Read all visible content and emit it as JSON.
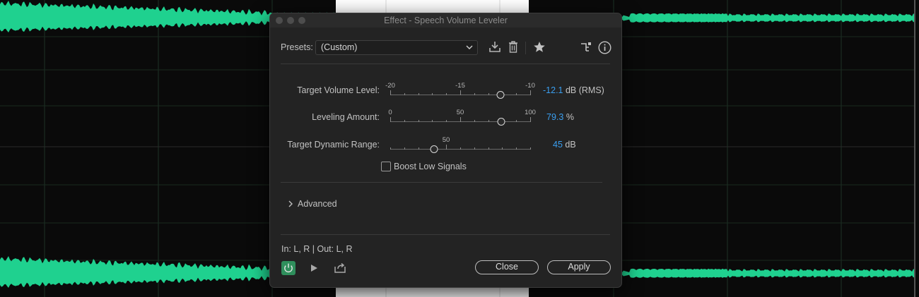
{
  "dialog": {
    "title": "Effect - Speech Volume Leveler",
    "presets_label": "Presets:",
    "preset_value": "(Custom)",
    "params": {
      "target_volume": {
        "label": "Target Volume Level:",
        "ticks": [
          "-20",
          "-15",
          "-10"
        ],
        "min": -20,
        "max": -10,
        "value": -12.1,
        "value_text": "-12.1",
        "unit": "dB (RMS)"
      },
      "leveling_amount": {
        "label": "Leveling Amount:",
        "ticks": [
          "0",
          "50",
          "100"
        ],
        "min": 0,
        "max": 100,
        "value": 79.3,
        "value_text": "79.3",
        "unit": "%"
      },
      "dynamic_range": {
        "label": "Target Dynamic Range:",
        "ticks": [
          "50"
        ],
        "min": 20,
        "max": 100,
        "value": 45,
        "value_text": "45",
        "unit": "dB"
      }
    },
    "boost_label": "Boost Low Signals",
    "boost_checked": false,
    "advanced_label": "Advanced",
    "io_text": "In: L, R | Out: L, R",
    "close_label": "Close",
    "apply_label": "Apply"
  },
  "colors": {
    "waveform": "#1fd18f",
    "value_accent": "#3a9ff0",
    "power_on": "#2f8f5c"
  }
}
